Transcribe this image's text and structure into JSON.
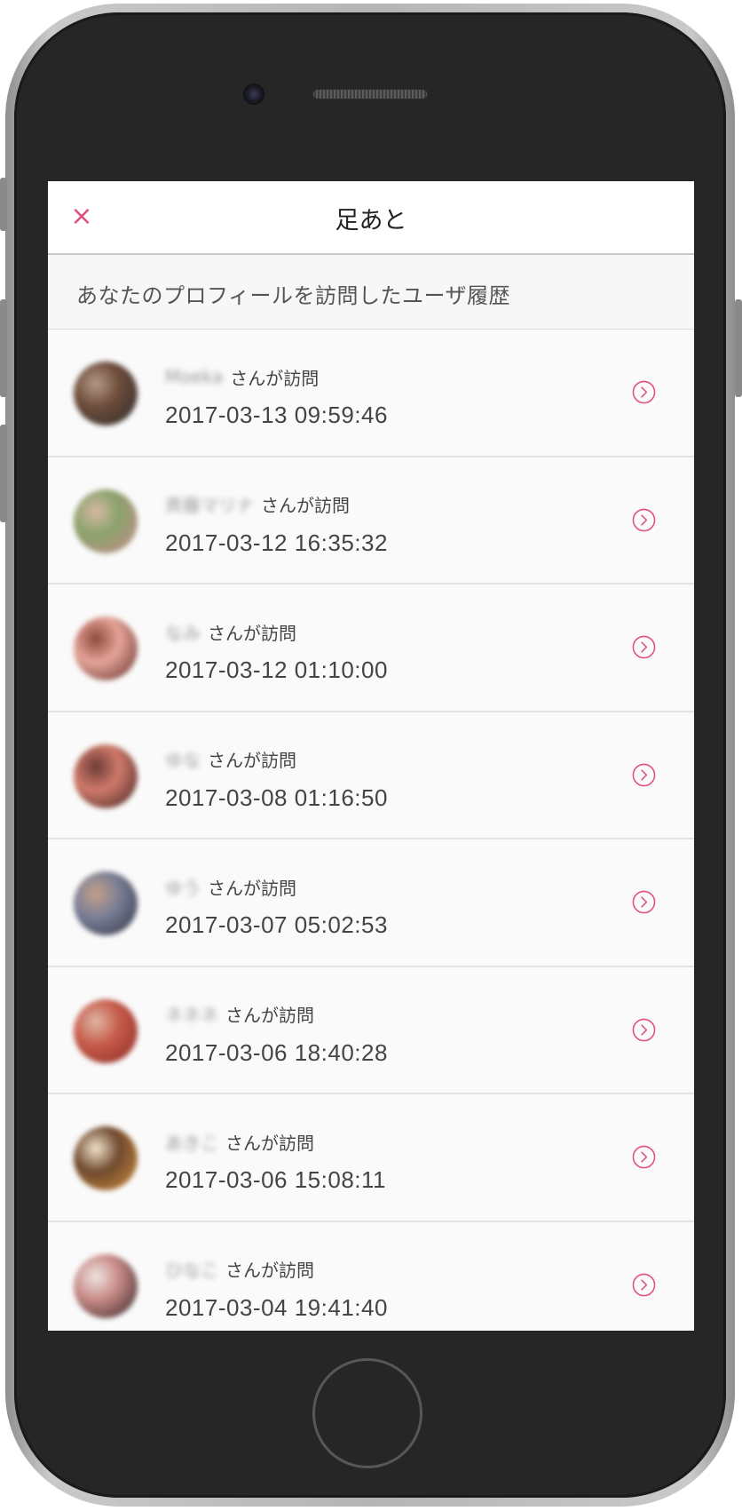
{
  "nav": {
    "title": "足あと",
    "close_label": "×"
  },
  "section": {
    "header": "あなたのプロフィールを訪問したユーザ履歴"
  },
  "visit_suffix": "さんが訪問",
  "colors": {
    "accent": "#e0507c"
  },
  "visits": [
    {
      "name": "Moeka",
      "timestamp": "2017-03-13 09:59:46",
      "avatar": [
        "#2b2b2b",
        "#6d4c3a",
        "#b59a86"
      ]
    },
    {
      "name": "斉藤マリナ",
      "timestamp": "2017-03-12 16:35:32",
      "avatar": [
        "#c98b8e",
        "#8aa26b",
        "#d6b9a5"
      ]
    },
    {
      "name": "なみ",
      "timestamp": "2017-03-12 01:10:00",
      "avatar": [
        "#5a2a22",
        "#e6a49a",
        "#8c4a3a"
      ]
    },
    {
      "name": "ゆな",
      "timestamp": "2017-03-08 01:16:50",
      "avatar": [
        "#3a1f1d",
        "#d07a6a",
        "#6b3b35"
      ]
    },
    {
      "name": "ゆう",
      "timestamp": "2017-03-07 05:02:53",
      "avatar": [
        "#2e3242",
        "#7b7f96",
        "#c3a08a"
      ]
    },
    {
      "name": "ネネネ",
      "timestamp": "2017-03-06 18:40:28",
      "avatar": [
        "#8a2a24",
        "#c65b4b",
        "#e0b7a4"
      ]
    },
    {
      "name": "あきこ",
      "timestamp": "2017-03-06 15:08:11",
      "avatar": [
        "#d48f3a",
        "#6f4a2e",
        "#f1e2cc"
      ]
    },
    {
      "name": "ひなこ",
      "timestamp": "2017-03-04 19:41:40",
      "avatar": [
        "#2b1f22",
        "#c78a86",
        "#efe5e2"
      ]
    }
  ]
}
